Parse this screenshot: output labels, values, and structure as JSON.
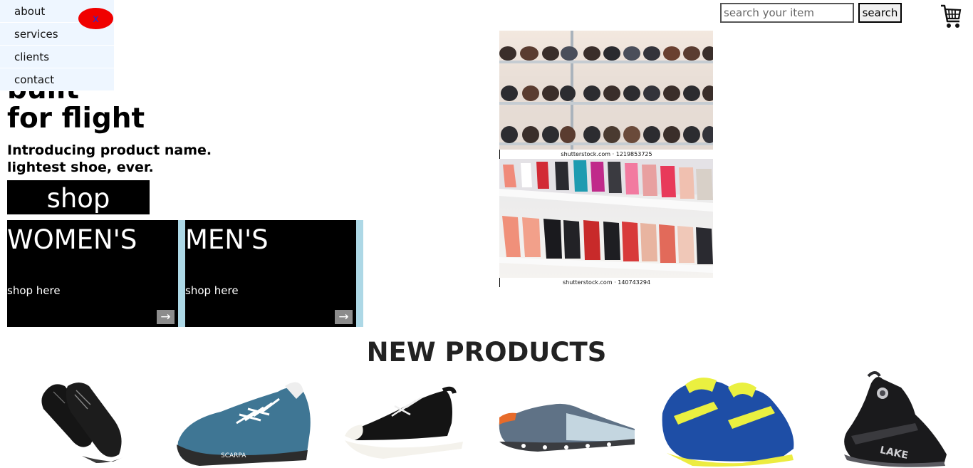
{
  "nav": {
    "items": [
      {
        "label": "about"
      },
      {
        "label": "services"
      },
      {
        "label": "clients"
      },
      {
        "label": "contact"
      }
    ],
    "close_label": "x"
  },
  "search": {
    "placeholder": "search your item",
    "button_label": "search"
  },
  "cart": {
    "icon": "cart-icon"
  },
  "hero": {
    "clipped_line": "built",
    "title": "for flight",
    "subtitle_line1": "Introducing product name.",
    "subtitle_line2": "lightest shoe, ever.",
    "shop_label": "shop"
  },
  "categories": [
    {
      "title": "WOMEN'S",
      "link": "shop here",
      "arrow": "→"
    },
    {
      "title": "MEN'S",
      "link": "shop here",
      "arrow": "→"
    }
  ],
  "photos": [
    {
      "caption": "shutterstock.com · 1219853725"
    },
    {
      "caption": "shutterstock.com · 140743294"
    }
  ],
  "new_products": {
    "title": "NEW PRODUCTS",
    "items": [
      {
        "name": "black-leather-shoes"
      },
      {
        "name": "blue-scarpa-sneaker",
        "brand_text": "SCARPA"
      },
      {
        "name": "black-canvas-sneaker"
      },
      {
        "name": "grey-running-shoe"
      },
      {
        "name": "blue-asics-shoe"
      },
      {
        "name": "black-lake-cycling-boot",
        "brand_text": "LAKE"
      }
    ]
  },
  "colors": {
    "close_button": "#f00000",
    "category_gap": "#add8e6",
    "nav_background": "#eef6ff"
  }
}
